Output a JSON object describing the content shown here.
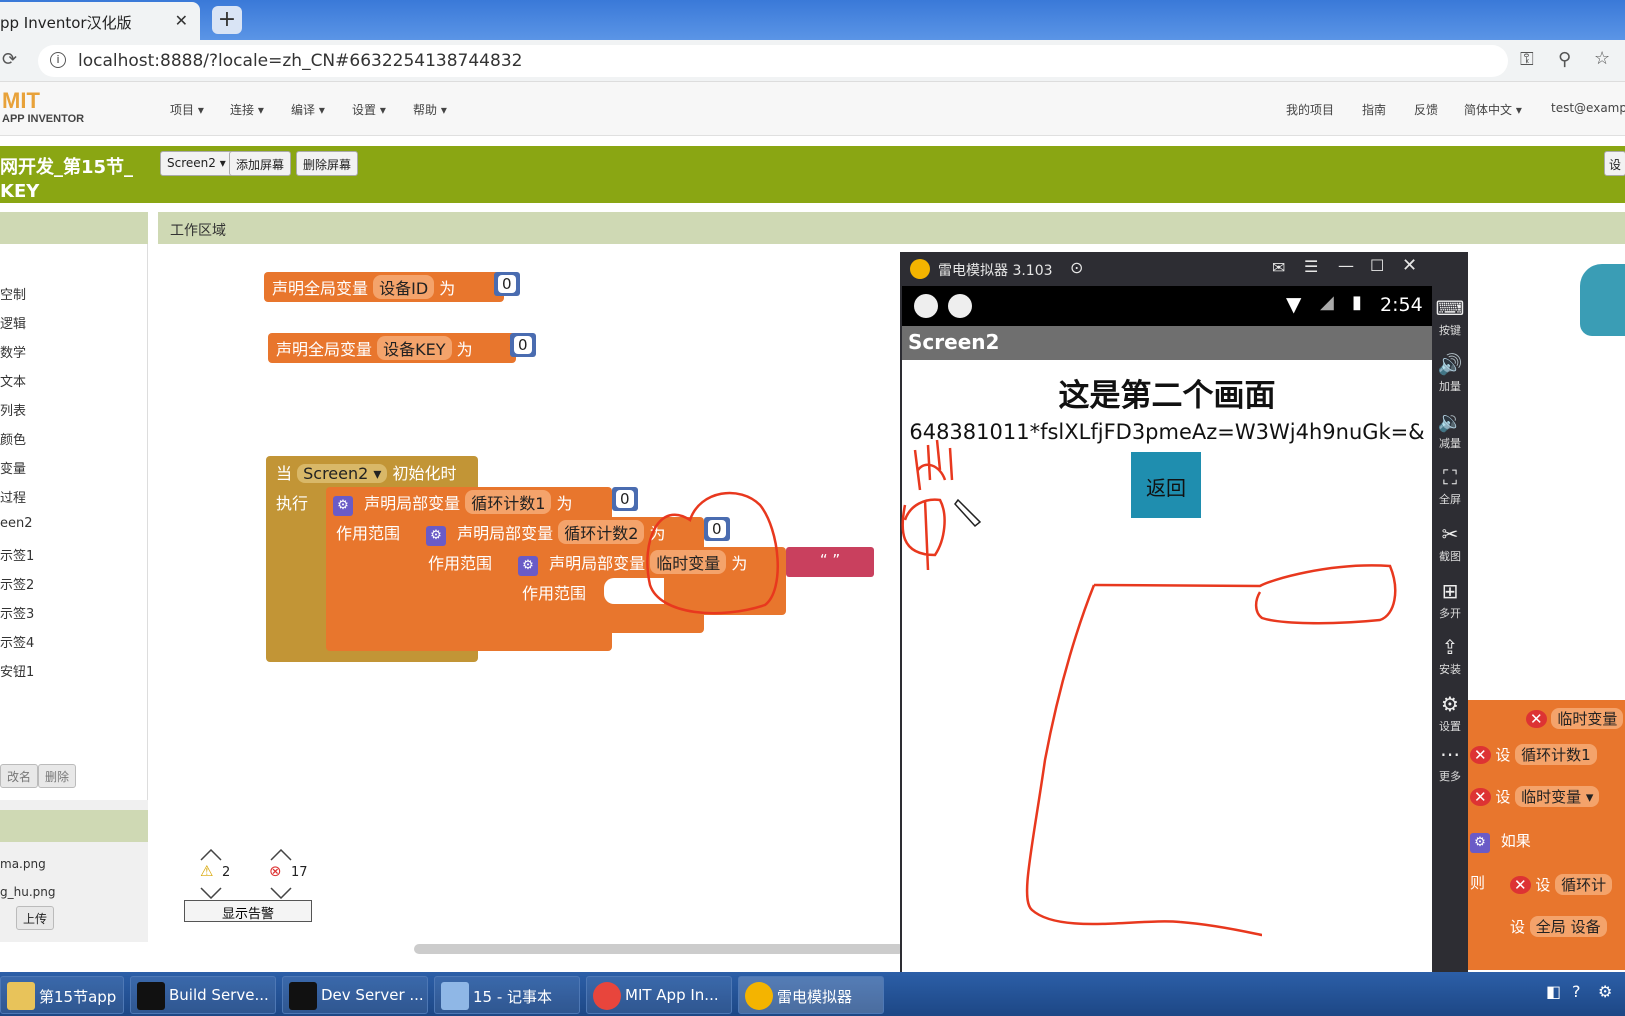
{
  "browser": {
    "tab_title": "pp Inventor汉化版",
    "tab_close": "✕",
    "new_tab": "+",
    "url": "localhost:8888/?locale=zh_CN#6632254138744832",
    "info_icon": "i"
  },
  "header": {
    "logo_mit": "MIT",
    "logo_sub": "APP INVENTOR",
    "menus": [
      "项目 ▾",
      "连接 ▾",
      "编译 ▾",
      "设置 ▾",
      "帮助 ▾"
    ],
    "right_links": [
      "我的项目",
      "指南",
      "反馈",
      "简体中文 ▾",
      "test@exampl"
    ]
  },
  "project": {
    "name_line1": "网开发_第15节_",
    "name_line2": "KEY",
    "screen_select": "Screen2 ▾",
    "add_screen": "添加屏幕",
    "delete_screen": "删除屏幕",
    "right_cut": "设"
  },
  "blocks_panel": {
    "items": [
      "空制",
      "逻辑",
      "数学",
      "文本",
      "列表",
      "颜色",
      "变量",
      "过程",
      "een2",
      "示签1",
      "示签2",
      "示签3",
      "示签4",
      "安钮1"
    ],
    "rename": "改名",
    "delete": "删除"
  },
  "media": {
    "files": [
      "ma.png",
      "g_hu.png"
    ],
    "upload": "上传"
  },
  "workspace": {
    "title": "工作区域",
    "g1_decl": "声明全局变量",
    "g1_name": "设备ID",
    "g1_as": "为",
    "g1_val": "0",
    "g2_decl": "声明全局变量",
    "g2_name": "设备KEY",
    "g2_as": "为",
    "g2_val": "0",
    "when": "当",
    "screen": "Screen2 ▾",
    "init": "初始化时",
    "do": "执行",
    "l1_decl": "声明局部变量",
    "l1_name": "循环计数1",
    "l1_as": "为",
    "l1_val": "0",
    "scope": "作用范围",
    "l2_decl": "声明局部变量",
    "l2_name": "循环计数2",
    "l2_as": "为",
    "l2_val": "0",
    "l3_decl": "声明局部变量",
    "l3_name": "临时变量",
    "l3_as": "为",
    "l3_str": "“ ”",
    "warn_count": "2",
    "err_count": "17",
    "show_warnings": "显示告警",
    "right_blocks": [
      "临时变量",
      "设",
      "循环计数1",
      "设",
      "临时变量 ▾",
      "如果",
      "则",
      "设",
      "循环计",
      "设",
      "全局 设备"
    ]
  },
  "emulator": {
    "title": "雷电模拟器 3.103",
    "time": "2:54",
    "screen_title": "Screen2",
    "heading": "这是第二个画面",
    "key_text": "648381011*fslXLfjFD3pmeAz=W3Wj4h9nuGk=&",
    "back_button": "返回",
    "tools": [
      {
        "icon": "keyboard-icon",
        "label": "按键"
      },
      {
        "icon": "volume-up-icon",
        "label": "加量"
      },
      {
        "icon": "volume-down-icon",
        "label": "减量"
      },
      {
        "icon": "fullscreen-icon",
        "label": "全屏"
      },
      {
        "icon": "scissors-icon",
        "label": "截图"
      },
      {
        "icon": "multi-open-icon",
        "label": "多开"
      },
      {
        "icon": "apk-icon",
        "label": "安装"
      },
      {
        "icon": "gear-icon",
        "label": "设置"
      },
      {
        "icon": "more-icon",
        "label": "更多"
      }
    ]
  },
  "taskbar": {
    "items": [
      "第15节app",
      "Build Serve...",
      "Dev Server ...",
      "15 - 记事本",
      "MIT App In...",
      "雷电模拟器"
    ]
  },
  "colors": {
    "green_bar": "#8aa613",
    "block_orange": "#e8762d",
    "event_gold": "#c29536",
    "number_blue": "#4a6cb0",
    "string_pink": "#c9405e",
    "annotation_red": "#e8381e",
    "back_button": "#1f8eaf"
  }
}
